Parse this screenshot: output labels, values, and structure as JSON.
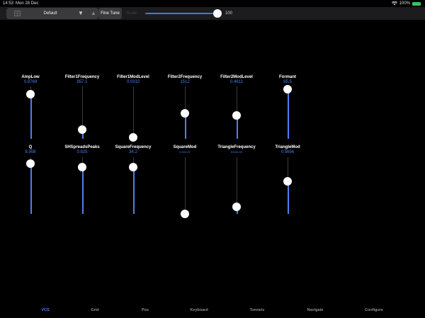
{
  "status_bar": {
    "time": "14:53",
    "date": "Mon 28 Dec",
    "battery_percent": "100%",
    "wifi_icon": "wifi-icon",
    "battery_color": "#34c759"
  },
  "toolbar": {
    "grid_icon": "grid-icon",
    "preset_name": "Default",
    "down_glyph": "▼",
    "up_glyph": "▲",
    "fine_tune_label": "Fine Tune",
    "slider_label": "Scale",
    "slider_value_label": "100",
    "slider_level": 1.0
  },
  "accent_color": "#4f7ff0",
  "sliders": [
    {
      "name": "AmpLow",
      "value": "0.8769",
      "level": 0.85
    },
    {
      "name": "Filter1Frequency",
      "value": "857.1",
      "level": 0.17
    },
    {
      "name": "Filter1ModLevel",
      "value": "0.0332",
      "level": 0.03
    },
    {
      "name": "Filter2Frequency",
      "value": "1512",
      "level": 0.48
    },
    {
      "name": "Filter2ModLevel",
      "value": "0.4611",
      "level": 0.45
    },
    {
      "name": "Formant",
      "value": "95.5",
      "level": 0.95
    },
    {
      "name": "Q",
      "value": "8.908",
      "level": 0.89
    },
    {
      "name": "SHSpreadsPeaks",
      "value": "0.825",
      "level": 0.82
    },
    {
      "name": "SquareFrequency",
      "value": "34.2",
      "level": 0.82
    },
    {
      "name": "SquareMod",
      "value": "2.92e-07",
      "level": 0.0
    },
    {
      "name": "TriangleFrequency",
      "value": "5.60e-05",
      "level": 0.12
    },
    {
      "name": "TriangleMod",
      "value": "0.5656",
      "level": 0.57
    }
  ],
  "tabs": [
    {
      "label": "VCS",
      "active": true
    },
    {
      "label": "Grid",
      "active": false
    },
    {
      "label": "Pos",
      "active": false
    },
    {
      "label": "Keyboard",
      "active": false
    },
    {
      "label": "Tonnetz",
      "active": false
    },
    {
      "label": "Navigate",
      "active": false
    },
    {
      "label": "Configure",
      "active": false
    }
  ]
}
